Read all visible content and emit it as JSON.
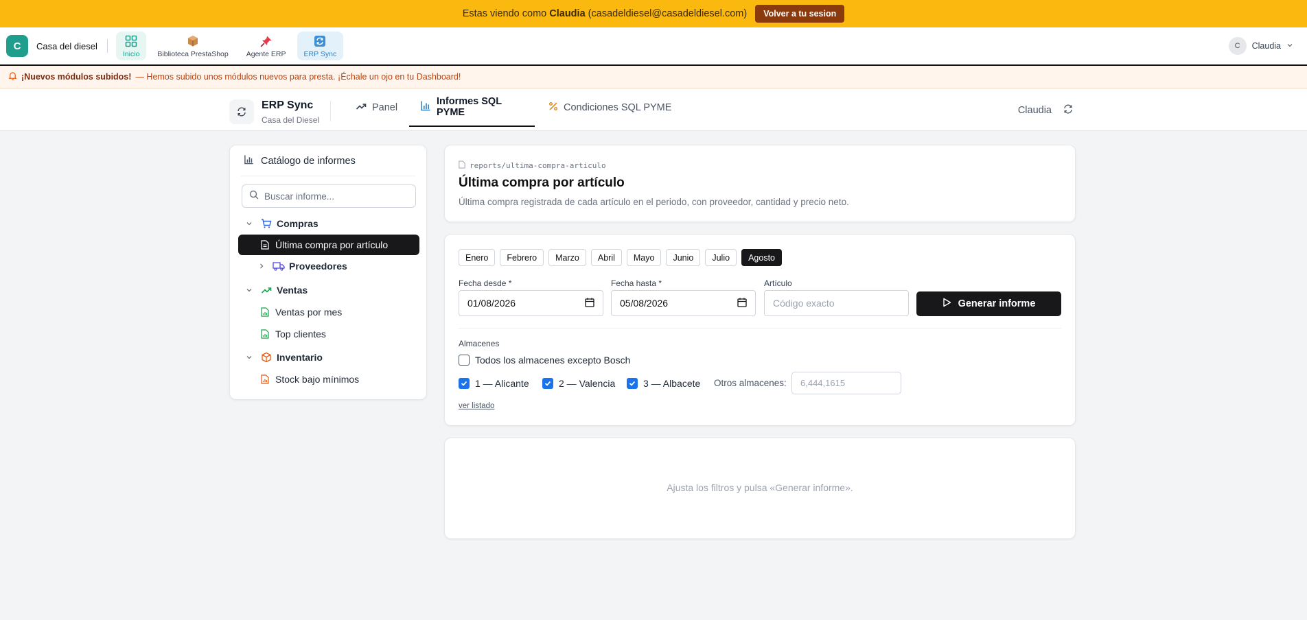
{
  "impersonation": {
    "prefix": "Estas viendo como",
    "user": "Claudia",
    "email": "(casadeldiesel@casadeldiesel.com)",
    "button": "Volver a tu sesion"
  },
  "app": {
    "brand_initial": "C",
    "brand_name": "Casa del diesel",
    "tabs": [
      {
        "label": "Inicio",
        "icon": "grid-icon"
      },
      {
        "label": "Biblioteca PrestaShop",
        "icon": "package-icon"
      },
      {
        "label": "Agente ERP",
        "icon": "pin-icon"
      },
      {
        "label": "ERP Sync",
        "icon": "sync-icon"
      }
    ],
    "user_initial": "C",
    "user_name": "Claudia"
  },
  "notice": {
    "title": "¡Nuevos módulos subidos!",
    "text": "— Hemos subido unos módulos nuevos para presta. ¡Échale un ojo en tu Dashboard!"
  },
  "module": {
    "title": "ERP Sync",
    "subtitle": "Casa del Diesel",
    "tabs": [
      {
        "label": "Panel",
        "icon": "trend-icon"
      },
      {
        "label": "Informes SQL PYME",
        "icon": "bar-chart-icon"
      },
      {
        "label": "Condiciones SQL PYME",
        "icon": "percent-icon"
      }
    ],
    "user": "Claudia"
  },
  "sidebar": {
    "title": "Catálogo de informes",
    "search_placeholder": "Buscar informe...",
    "groups": {
      "compras": "Compras",
      "ultima": "Última compra por artículo",
      "proveedores": "Proveedores",
      "ventas": "Ventas",
      "ventas_mes": "Ventas por mes",
      "top_clientes": "Top clientes",
      "inventario": "Inventario",
      "stock": "Stock bajo mínimos"
    }
  },
  "report": {
    "path": "reports/ultima-compra-articulo",
    "title": "Última compra por artículo",
    "description": "Última compra registrada de cada artículo en el periodo, con proveedor, cantidad y precio neto."
  },
  "filters": {
    "months": [
      "Enero",
      "Febrero",
      "Marzo",
      "Abril",
      "Mayo",
      "Junio",
      "Julio",
      "Agosto"
    ],
    "active_month": "Agosto",
    "fecha_desde_label": "Fecha desde *",
    "fecha_desde": "01/08/2026",
    "fecha_hasta_label": "Fecha hasta *",
    "fecha_hasta": "05/08/2026",
    "articulo_label": "Artículo",
    "articulo_placeholder": "Código exacto",
    "generate": "Generar informe",
    "almacenes_label": "Almacenes",
    "all_except_bosch": "Todos los almacenes excepto Bosch",
    "almacenes": [
      {
        "label": "1 — Alicante",
        "checked": true
      },
      {
        "label": "2 — Valencia",
        "checked": true
      },
      {
        "label": "3 — Albacete",
        "checked": true
      }
    ],
    "otros_label": "Otros almacenes:",
    "otros_placeholder": "6,444,1615",
    "ver_listado": "ver listado"
  },
  "results": {
    "empty": "Ajusta los filtros y pulsa «Generar informe»."
  },
  "colors": {
    "banner": "#fbb80f",
    "accent_teal": "#1f9e8e",
    "accent_blue": "#2b7fc2",
    "dark": "#18181b",
    "checkbox": "#1a73e8"
  }
}
